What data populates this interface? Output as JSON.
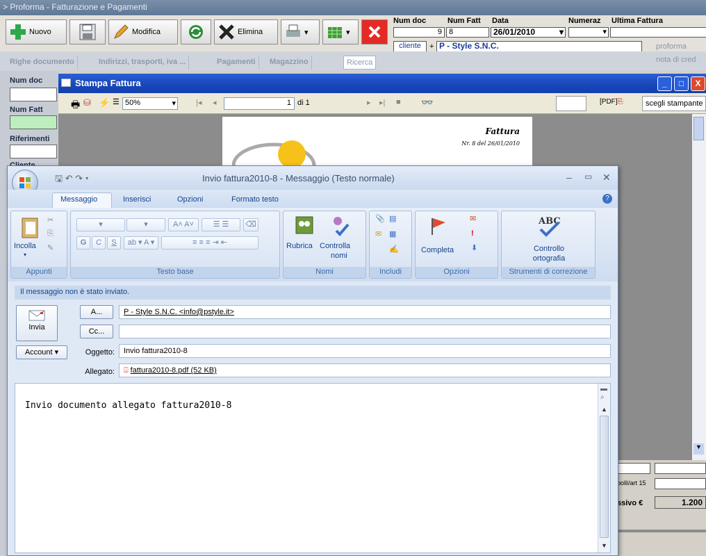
{
  "app": {
    "title": "> Proforma - Fatturazione e Pagamenti",
    "toolbar": {
      "nuovo": "Nuovo",
      "modifica": "Modifica",
      "elimina": "Elimina"
    },
    "doc_fields": {
      "num_doc_label": "Num doc",
      "num_doc_value": "9",
      "num_fatt_label": "Num Fatt",
      "num_fatt_value": "8",
      "data_label": "Data",
      "data_value": "26/01/2010",
      "numeraz_label": "Numeraz",
      "ultima_fattura_label": "Ultima Fattura",
      "cliente_button": "cliente",
      "plus": "+",
      "cliente_value": "P - Style S.N.C.",
      "proforma_label": "proforma",
      "nota_label": "nota di cred"
    },
    "tabs": [
      "Righe documento",
      "Indirizzi, trasporti, iva ...",
      "Pagamenti",
      "Magazzino",
      "Ricerca"
    ],
    "left_panel": {
      "num_doc": "Num doc",
      "num_fatt": "Num Fatt",
      "riferimenti": "Riferimenti",
      "cliente": "Cliente"
    },
    "right_panel": {
      "bolli": "bolli/art 15",
      "totale": "ssivo €",
      "totale_value": "1.200"
    }
  },
  "stampa": {
    "title": "Stampa Fattura",
    "zoom": "50%",
    "page_current": "1",
    "page_of": "di 1",
    "pdf_label": "[PDF]",
    "printer_label": "scegli stampante",
    "paper": {
      "heading": "Fattura",
      "subheading": "Nr. 8 del 26/01/2010"
    }
  },
  "outlook": {
    "title": "Invio fattura2010-8 - Messaggio (Testo normale)",
    "tabs": [
      "Messaggio",
      "Inserisci",
      "Opzioni",
      "Formato testo"
    ],
    "ribbon": {
      "incolla": "Incolla",
      "appunti": "Appunti",
      "testo_base": "Testo base",
      "rubrica": "Rubrica",
      "controlla": "Controlla",
      "nomi_btn": "nomi",
      "nomi": "Nomi",
      "includi": "Includi",
      "completa": "Completa",
      "opzioni": "Opzioni",
      "controllo": "Controllo",
      "ortografia": "ortografia",
      "strumenti": "Strumenti di correzione",
      "bold": "G",
      "italic": "C",
      "underline": "S"
    },
    "info_bar": "Il messaggio non è stato inviato.",
    "invia": "Invia",
    "a_button": "A...",
    "cc_button": "Cc...",
    "account_button": "Account",
    "oggetto_label": "Oggetto:",
    "allegato_label": "Allegato:",
    "to_value": "P - Style S.N.C. <info@pstyle.it>",
    "cc_value": "",
    "subject_value": "Invio fattura2010-8",
    "attachment": "fattura2010-8.pdf (52 KB)",
    "body": "Invio documento allegato fattura2010-8"
  }
}
